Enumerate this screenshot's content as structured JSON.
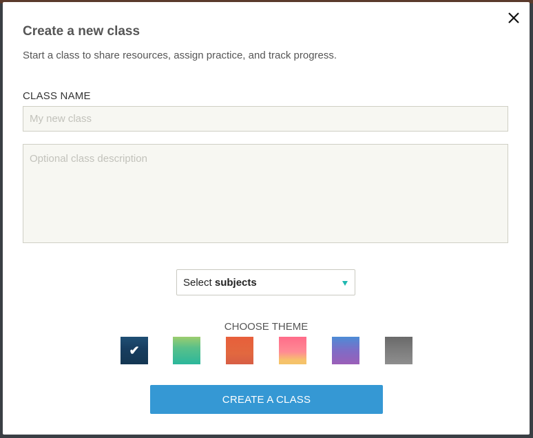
{
  "modal": {
    "title": "Create a new class",
    "subtitle": "Start a class to share resources, assign practice, and track progress.",
    "close_icon": "close-icon"
  },
  "form": {
    "class_name_label": "CLASS NAME",
    "class_name_placeholder": "My new class",
    "class_name_value": "",
    "description_placeholder": "Optional class description",
    "description_value": "",
    "subjects_select": {
      "prefix": "Select",
      "emphasis": "subjects",
      "arrow_color": "#1fb8b0"
    }
  },
  "theme": {
    "label": "CHOOSE THEME",
    "selected_index": 0,
    "swatches": [
      {
        "name": "navy",
        "colors": [
          "#1f4f74",
          "#143652"
        ]
      },
      {
        "name": "green",
        "colors": [
          "#9ccd6e",
          "#2bb79b"
        ]
      },
      {
        "name": "orange",
        "colors": [
          "#e85f3b",
          "#d75e45"
        ]
      },
      {
        "name": "pink",
        "colors": [
          "#ff6c8a",
          "#f4c36a"
        ]
      },
      {
        "name": "purple",
        "colors": [
          "#4d8cd6",
          "#9b5fb8"
        ]
      },
      {
        "name": "gray",
        "colors": [
          "#6a6a6a",
          "#8e8e8e"
        ]
      }
    ],
    "check_glyph": "✔"
  },
  "actions": {
    "create_label": "CREATE A CLASS",
    "create_color": "#3598d4"
  }
}
